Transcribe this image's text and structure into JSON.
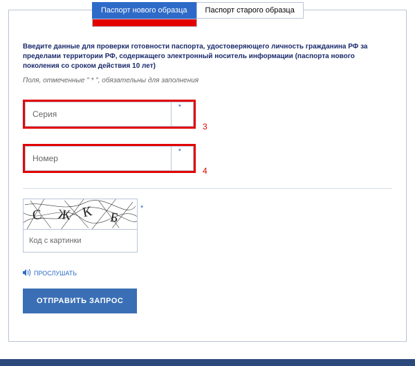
{
  "tabs": {
    "active": "Паспорт нового образца",
    "inactive": "Паспорт старого образца"
  },
  "intro": "Введите данные для проверки готовности паспорта, удостоверяющего личность гражданина РФ за пределами территории РФ, содержащего электронный носитель информации (паспорта нового поколения со сроком действия 10 лет)",
  "hint": "Поля, отмеченные \" * \", обязательны для заполнения",
  "fields": {
    "series": {
      "placeholder": "Серия",
      "marker": "3"
    },
    "number": {
      "placeholder": "Номер",
      "marker": "4"
    }
  },
  "captcha": {
    "letters": [
      "С",
      "Ж",
      "К",
      "Б"
    ],
    "input_placeholder": "Код с картинки",
    "listen": "ПРОСЛУШАТЬ"
  },
  "submit": "ОТПРАВИТЬ ЗАПРОС"
}
